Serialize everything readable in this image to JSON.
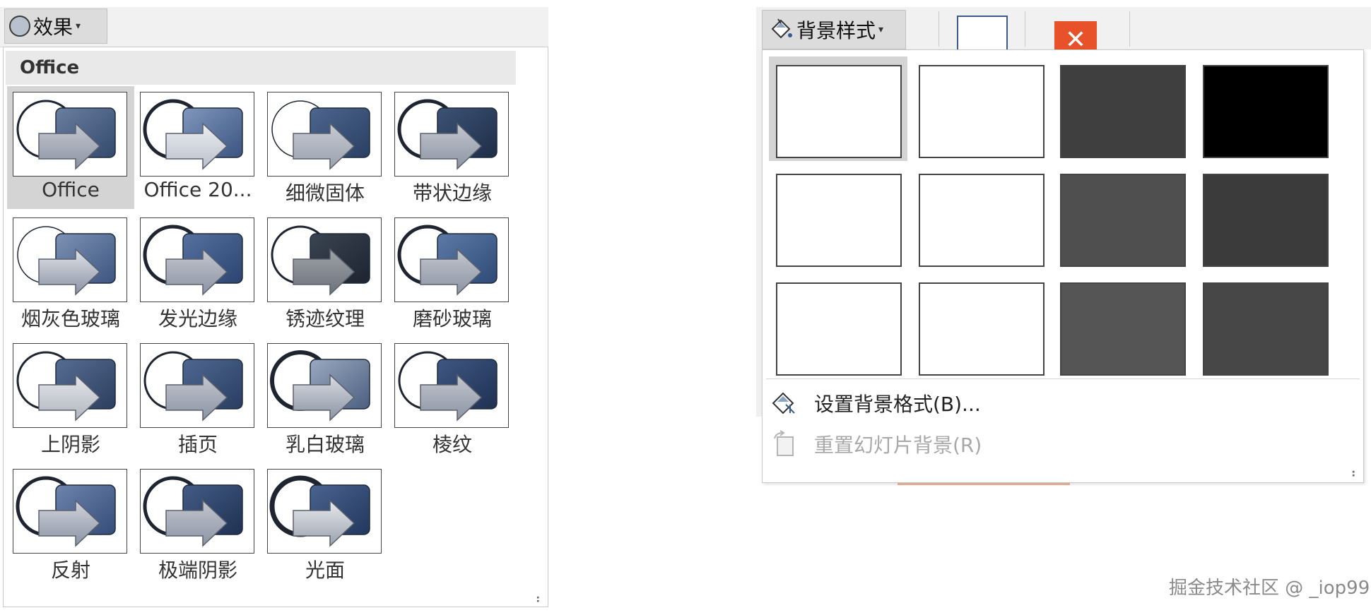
{
  "effects": {
    "button_label": "效果",
    "section_header": "Office",
    "items": [
      {
        "label": "Office",
        "selected": true
      },
      {
        "label": "Office 20...",
        "selected": false
      },
      {
        "label": "细微固体",
        "selected": false
      },
      {
        "label": "带状边缘",
        "selected": false
      },
      {
        "label": "烟灰色玻璃",
        "selected": false
      },
      {
        "label": "发光边缘",
        "selected": false
      },
      {
        "label": "锈迹纹理",
        "selected": false
      },
      {
        "label": "磨砂玻璃",
        "selected": false
      },
      {
        "label": "上阴影",
        "selected": false
      },
      {
        "label": "插页",
        "selected": false
      },
      {
        "label": "乳白玻璃",
        "selected": false
      },
      {
        "label": "棱纹",
        "selected": false
      },
      {
        "label": "反射",
        "selected": false
      },
      {
        "label": "极端阴影",
        "selected": false
      },
      {
        "label": "光面",
        "selected": false
      }
    ]
  },
  "background_styles": {
    "button_label": "背景样式",
    "swatches": [
      {
        "color": "#ffffff",
        "selected": true
      },
      {
        "color": "#ffffff",
        "selected": false
      },
      {
        "color": "#3f3f3f",
        "selected": false
      },
      {
        "color": "#000000",
        "selected": false
      },
      {
        "color": "#ffffff",
        "selected": false
      },
      {
        "color": "#ffffff",
        "selected": false
      },
      {
        "color": "#4f4f4f",
        "selected": false
      },
      {
        "color": "#3b3b3b",
        "selected": false
      },
      {
        "color": "#ffffff",
        "selected": false
      },
      {
        "color": "#ffffff",
        "selected": false
      },
      {
        "color": "#555555",
        "selected": false
      },
      {
        "color": "#474747",
        "selected": false
      }
    ],
    "menu": [
      {
        "label": "设置背景格式(B)...",
        "icon": "format-background-icon",
        "enabled": true
      },
      {
        "label": "重置幻灯片背景(R)",
        "icon": "reset-background-icon",
        "enabled": false
      }
    ]
  },
  "ribbon": {
    "close_glyph": "✕"
  },
  "watermark": "掘金技术社区 @ _iop99",
  "colors": {
    "accent_blue": "#3b5a8a",
    "close_orange": "#e8522a",
    "selection_gray": "#d4d4d4"
  }
}
